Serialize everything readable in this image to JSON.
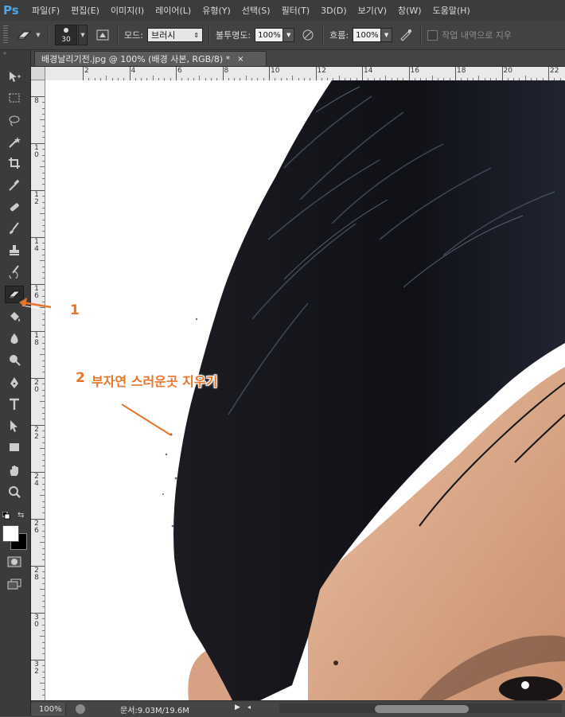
{
  "app": {
    "logo": "Ps"
  },
  "menu": [
    "파일(F)",
    "편집(E)",
    "이미지(I)",
    "레이어(L)",
    "유형(Y)",
    "선택(S)",
    "필터(T)",
    "3D(D)",
    "보기(V)",
    "창(W)",
    "도움말(H)"
  ],
  "options": {
    "brush_size": "30",
    "mode_label": "모드:",
    "mode_value": "브러시",
    "opacity_label": "불투명도:",
    "opacity_value": "100%",
    "flow_label": "흐름:",
    "flow_value": "100%",
    "erase_history_label": "작업 내역으로 지우"
  },
  "document": {
    "tab_title": "배경날리기전.jpg @ 100% (배경 사본, RGB/8) *",
    "close_glyph": "×"
  },
  "rulers": {
    "horizontal": [
      "2",
      "4",
      "6",
      "8",
      "10",
      "12",
      "14",
      "16",
      "18",
      "20",
      "22"
    ],
    "vertical": [
      "8",
      "10",
      "12",
      "14",
      "16",
      "18",
      "20",
      "22",
      "24",
      "26",
      "28",
      "30",
      "32"
    ]
  },
  "status": {
    "zoom": "100%",
    "doc_size": "문서:9.03M/19.6M"
  },
  "annotations": {
    "label1": "1",
    "label2_num": "2",
    "label2_text": "부자연 스러운곳 지우기"
  },
  "colors": {
    "accent": "#e8742a",
    "ps_blue": "#4aa8e8",
    "hair": "#15161a",
    "skin": "#d9a987"
  },
  "toolbox_icons": [
    "move-icon",
    "marquee-icon",
    "lasso-icon",
    "magic-wand-icon",
    "crop-icon",
    "eyedropper-icon",
    "healing-brush-icon",
    "brush-icon",
    "clone-stamp-icon",
    "history-brush-icon",
    "eraser-icon",
    "paint-bucket-icon",
    "blur-icon",
    "dodge-icon",
    "pen-icon",
    "type-icon",
    "path-selection-icon",
    "rectangle-icon",
    "hand-icon",
    "zoom-icon"
  ]
}
